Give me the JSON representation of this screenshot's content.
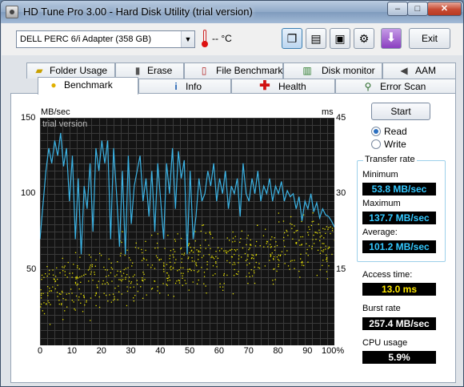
{
  "window": {
    "title": "HD Tune Pro 3.00 - Hard Disk Utility (trial version)"
  },
  "titlebar": {
    "minimize": "–",
    "maximize": "□",
    "close": "✕"
  },
  "toolbar": {
    "drive": "DELL    PERC 6/i Adapter (358 GB)",
    "temperature": "-- °C",
    "exit_label": "Exit"
  },
  "tabs_top": [
    {
      "label": "Folder Usage",
      "icon": "folder-icon"
    },
    {
      "label": "Erase",
      "icon": "trash-icon"
    },
    {
      "label": "File Benchmark",
      "icon": "file-benchmark-icon"
    },
    {
      "label": "Disk monitor",
      "icon": "monitor-icon"
    },
    {
      "label": "AAM",
      "icon": "speaker-icon"
    }
  ],
  "tabs_bottom": [
    {
      "label": "Benchmark",
      "icon": "bulb-icon",
      "active": true
    },
    {
      "label": "Info",
      "icon": "info-icon"
    },
    {
      "label": "Health",
      "icon": "health-cross-icon"
    },
    {
      "label": "Error Scan",
      "icon": "magnifier-icon"
    }
  ],
  "chart": {
    "left_unit": "MB/sec",
    "right_unit": "ms",
    "watermark": "trial version",
    "left_ticks": [
      "150",
      "100",
      "50"
    ],
    "right_ticks": [
      "45",
      "30",
      "15"
    ],
    "x_ticks": [
      "0",
      "10",
      "20",
      "30",
      "40",
      "50",
      "60",
      "70",
      "80",
      "90",
      "100%"
    ]
  },
  "chart_data": {
    "type": "line",
    "title": "",
    "xlabel": "",
    "ylabel": "MB/sec",
    "y2label": "ms",
    "xlim": [
      0,
      100
    ],
    "ylim": [
      0,
      150
    ],
    "y2lim": [
      0,
      45
    ],
    "grid": true,
    "series": [
      {
        "axis": "left",
        "color": "#3bb4e6",
        "x": [
          0,
          2,
          3,
          4,
          5,
          6,
          7,
          8,
          9,
          10,
          11,
          12,
          13,
          14,
          15,
          16,
          17,
          18,
          19,
          20,
          21,
          22,
          23,
          24,
          25,
          26,
          27,
          28,
          29,
          30,
          31,
          32,
          33,
          34,
          35,
          36,
          37,
          38,
          39,
          40,
          41,
          42,
          43,
          44,
          45,
          46,
          47,
          48,
          49,
          50,
          51,
          52,
          53,
          54,
          55,
          56,
          57,
          58,
          59,
          60,
          61,
          62,
          63,
          64,
          65,
          66,
          67,
          68,
          69,
          70,
          71,
          72,
          73,
          74,
          75,
          76,
          77,
          78,
          79,
          80,
          81,
          82,
          83,
          84,
          85,
          86,
          87,
          88,
          89,
          90,
          91,
          92,
          93,
          94,
          95,
          96,
          97,
          98,
          99,
          100
        ],
        "values": [
          70,
          115,
          130,
          120,
          135,
          125,
          140,
          118,
          130,
          95,
          125,
          70,
          110,
          60,
          105,
          90,
          120,
          75,
          130,
          115,
          135,
          120,
          135,
          70,
          130,
          100,
          65,
          115,
          60,
          125,
          80,
          105,
          115,
          125,
          95,
          110,
          85,
          115,
          75,
          120,
          95,
          70,
          120,
          100,
          130,
          90,
          128,
          110,
          122,
          60,
          115,
          70,
          85,
          110,
          95,
          100,
          115,
          105,
          120,
          95,
          110,
          100,
          115,
          90,
          105,
          100,
          110,
          85,
          120,
          100,
          95,
          110,
          100,
          115,
          95,
          105,
          100,
          110,
          95,
          105,
          100,
          108,
          95,
          102,
          98,
          100,
          90,
          98,
          82,
          95,
          90,
          100,
          88,
          94,
          84,
          90,
          86,
          85,
          82,
          78
        ]
      },
      {
        "axis": "right",
        "color": "#e6e000",
        "style": "scatter",
        "trend": [
          [
            0,
            11
          ],
          [
            10,
            12.5
          ],
          [
            20,
            13.5
          ],
          [
            30,
            14.5
          ],
          [
            40,
            15.5
          ],
          [
            50,
            16.5
          ],
          [
            60,
            17.5
          ],
          [
            70,
            18.5
          ],
          [
            80,
            19.5
          ],
          [
            90,
            20
          ],
          [
            100,
            20.5
          ]
        ],
        "spread": 9
      }
    ]
  },
  "controls": {
    "start_label": "Start",
    "read_label": "Read",
    "write_label": "Write",
    "mode": "Read"
  },
  "results": {
    "transfer_rate_title": "Transfer rate",
    "minimum_label": "Minimum",
    "minimum_value": "53.8 MB/sec",
    "maximum_label": "Maximum",
    "maximum_value": "137.7 MB/sec",
    "average_label": "Average:",
    "average_value": "101.2 MB/sec",
    "access_label": "Access time:",
    "access_value": "13.0 ms",
    "burst_label": "Burst rate",
    "burst_value": "257.4 MB/sec",
    "cpu_label": "CPU usage",
    "cpu_value": "5.9%"
  },
  "colors": {
    "read_line": "#3bb4e6",
    "access_dots": "#e6e000",
    "plot_bg": "#141414",
    "grid": "#3a3a3a"
  }
}
